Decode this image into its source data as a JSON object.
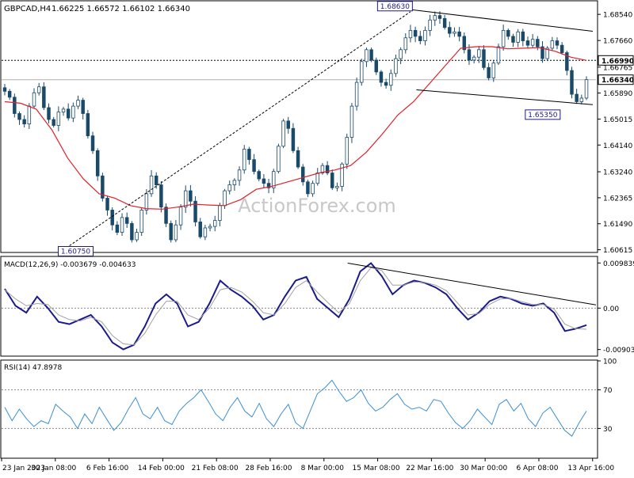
{
  "header": {
    "symbol": "GBPCAD,H4",
    "ohlc": "1.66225 1.66572 1.66102 1.66340"
  },
  "watermark": "ActionForex.com",
  "colors": {
    "background": "#ffffff",
    "grid": "#c8c8c8",
    "candle": "#1a4a6a",
    "ma": "#e0202a",
    "macd_line": "#1a1a8c",
    "signal_line": "#a0a0a0",
    "rsi_line": "#3a8fd0",
    "trendline": "#000000",
    "watermark": "#c8c8c8"
  },
  "chart_data": [
    {
      "type": "line",
      "title": "GBPCAD,H4",
      "x_tick_labels": [
        "23 Jan 2023",
        "30 Jan 08:00",
        "6 Feb 16:00",
        "14 Feb 00:00",
        "21 Feb 08:00",
        "28 Feb 16:00",
        "8 Mar 00:00",
        "15 Mar 08:00",
        "22 Mar 16:00",
        "30 Mar 00:00",
        "6 Apr 08:00",
        "13 Apr 16:00"
      ],
      "y_ticks": [
        "1.68540",
        "1.67660",
        "1.66765",
        "1.65890",
        "1.65015",
        "1.64140",
        "1.63240",
        "1.62365",
        "1.61490",
        "1.60615"
      ],
      "ylim": [
        1.6055,
        1.6897
      ],
      "price_labels": {
        "last": "1.66340",
        "level": "1.66990"
      },
      "annotations": [
        {
          "text": "1.68630",
          "date": "20 Mar 2023",
          "price": 1.6863
        },
        {
          "text": "1.60750",
          "date": "3 Feb 2023",
          "price": 1.6075
        },
        {
          "text": "1.65350",
          "date": "13 Apr 2023",
          "price": 1.6535
        }
      ],
      "horizontal_lines": [
        1.6699,
        1.6634
      ],
      "trendlines": [
        {
          "from": [
            "3 Feb",
            1.6075
          ],
          "to": [
            "20 Mar",
            1.6863
          ],
          "style": "dashed"
        },
        {
          "from": [
            "20 Mar",
            1.687
          ],
          "to": [
            "17 Apr",
            1.6797
          ],
          "style": "solid"
        },
        {
          "from": [
            "22 Mar",
            1.66
          ],
          "to": [
            "17 Apr",
            1.655
          ],
          "style": "solid"
        }
      ],
      "series": [
        {
          "label": "candles",
          "close": [
            1.6595,
            1.6575,
            1.652,
            1.65,
            1.6485,
            1.6545,
            1.659,
            1.661,
            1.654,
            1.65,
            1.648,
            1.6525,
            1.6535,
            1.6505,
            1.6545,
            1.6565,
            1.652,
            1.6445,
            1.6395,
            1.631,
            1.6235,
            1.6195,
            1.6145,
            1.612,
            1.617,
            1.615,
            1.6095,
            1.612,
            1.6195,
            1.625,
            1.631,
            1.628,
            1.6205,
            1.615,
            1.6095,
            1.6145,
            1.6205,
            1.626,
            1.6225,
            1.6155,
            1.6105,
            1.6135,
            1.614,
            1.616,
            1.621,
            1.626,
            1.628,
            1.6295,
            1.633,
            1.64,
            1.6365,
            1.6325,
            1.63,
            1.6285,
            1.627,
            1.6325,
            1.641,
            1.6495,
            1.647,
            1.6395,
            1.634,
            1.629,
            1.625,
            1.6285,
            1.632,
            1.6345,
            1.632,
            1.627,
            1.6275,
            1.635,
            1.644,
            1.6545,
            1.6625,
            1.6695,
            1.6735,
            1.67,
            1.666,
            1.6625,
            1.6615,
            1.6655,
            1.6705,
            1.6735,
            1.6775,
            1.68,
            1.678,
            1.6765,
            1.68,
            1.6835,
            1.685,
            1.684,
            1.681,
            1.679,
            1.6795,
            1.678,
            1.6735,
            1.67,
            1.671,
            1.6735,
            1.6675,
            1.664,
            1.669,
            1.6745,
            1.68,
            1.678,
            1.676,
            1.6795,
            1.6765,
            1.675,
            1.677,
            1.6745,
            1.6705,
            1.674,
            1.6765,
            1.675,
            1.6725,
            1.6665,
            1.6585,
            1.656,
            1.6572,
            1.6634
          ]
        },
        {
          "label": "moving-average",
          "values": [
            1.656,
            1.6555,
            1.6535,
            1.6465,
            1.637,
            1.63,
            1.625,
            1.6235,
            1.621,
            1.62,
            1.6198,
            1.6205,
            1.6215,
            1.6212,
            1.621,
            1.623,
            1.6265,
            1.6275,
            1.629,
            1.6305,
            1.632,
            1.633,
            1.6345,
            1.639,
            1.645,
            1.6515,
            1.656,
            1.662,
            1.668,
            1.674,
            1.6745,
            1.6745,
            1.6738,
            1.674,
            1.6742,
            1.673,
            1.671,
            1.6699
          ]
        }
      ]
    },
    {
      "type": "line",
      "title": "MACD(12,26,9) -0.003679 -0.004633",
      "y_ticks": [
        "0.009839",
        "0.00",
        "-0.009036"
      ],
      "ylim": [
        -0.0103,
        0.0111
      ],
      "trendline": {
        "from": [
          "15 Mar",
          0.0098
        ],
        "to": [
          "17 Apr",
          0.0007
        ]
      },
      "series": [
        {
          "name": "macd",
          "values": [
            0.0042,
            0.0005,
            -0.001,
            0.0025,
            0.0,
            -0.003,
            -0.0035,
            -0.0025,
            -0.0015,
            -0.004,
            -0.0075,
            -0.009,
            -0.008,
            -0.004,
            0.001,
            0.003,
            0.001,
            -0.004,
            -0.003,
            0.001,
            0.006,
            0.004,
            0.0025,
            0.0005,
            -0.0025,
            -0.0015,
            0.0025,
            0.006,
            0.0068,
            0.002,
            0.0,
            -0.002,
            0.002,
            0.008,
            0.0098,
            0.007,
            0.003,
            0.005,
            0.006,
            0.0055,
            0.0045,
            0.003,
            0.0,
            -0.0025,
            -0.001,
            0.0015,
            0.0025,
            0.002,
            0.001,
            0.0005,
            0.001,
            -0.001,
            -0.005,
            -0.0045,
            -0.0037
          ]
        },
        {
          "name": "signal",
          "values": [
            0.004,
            0.002,
            0.0005,
            0.001,
            0.0008,
            -0.0015,
            -0.0025,
            -0.0028,
            -0.002,
            -0.003,
            -0.006,
            -0.0078,
            -0.008,
            -0.0055,
            -0.0015,
            0.0015,
            0.0015,
            -0.0015,
            -0.0025,
            0.0,
            0.004,
            0.0045,
            0.0035,
            0.0015,
            -0.001,
            -0.0015,
            0.001,
            0.0045,
            0.006,
            0.0035,
            0.0012,
            -0.001,
            0.001,
            0.006,
            0.0088,
            0.0082,
            0.005,
            0.005,
            0.0057,
            0.0056,
            0.005,
            0.0038,
            0.0012,
            -0.0015,
            -0.0012,
            0.0008,
            0.002,
            0.0021,
            0.0014,
            0.0008,
            0.0008,
            -0.0002,
            -0.0035,
            -0.0045,
            -0.0046
          ]
        }
      ]
    },
    {
      "type": "line",
      "title": "RSI(14) 47.8978",
      "y_ticks": [
        "100",
        "70",
        "30",
        "0"
      ],
      "ylim": [
        0,
        100
      ],
      "reference_lines": [
        70,
        30
      ],
      "series": [
        {
          "name": "rsi",
          "values": [
            52,
            38,
            50,
            40,
            32,
            38,
            35,
            55,
            48,
            42,
            30,
            45,
            35,
            52,
            40,
            28,
            36,
            50,
            62,
            45,
            40,
            52,
            38,
            34,
            48,
            56,
            62,
            70,
            58,
            45,
            38,
            52,
            62,
            48,
            42,
            56,
            40,
            32,
            45,
            55,
            36,
            30,
            48,
            66,
            72,
            80,
            68,
            58,
            62,
            70,
            56,
            48,
            52,
            60,
            66,
            55,
            50,
            52,
            48,
            60,
            58,
            46,
            36,
            30,
            38,
            50,
            42,
            34,
            55,
            60,
            48,
            56,
            40,
            32,
            46,
            52,
            40,
            28,
            22,
            36,
            48
          ]
        }
      ]
    }
  ]
}
